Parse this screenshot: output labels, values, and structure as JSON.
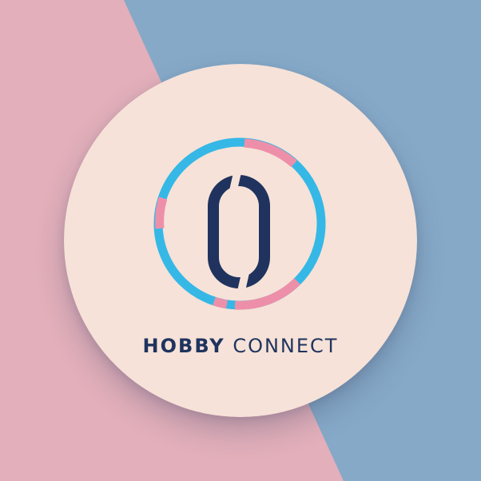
{
  "brand": {
    "name_bold": "HOBBY",
    "name_light": "CONNECT",
    "logo_glyph": "0"
  },
  "icons": {
    "logo": "ring-with-zero-icon"
  },
  "colors": {
    "background_pink": "#E2AFBA",
    "background_blue": "#86A9C8",
    "badge": "#F6E2D8",
    "navy": "#1F335E",
    "cyan": "#35B8E6",
    "pink": "#EE8FAA"
  }
}
